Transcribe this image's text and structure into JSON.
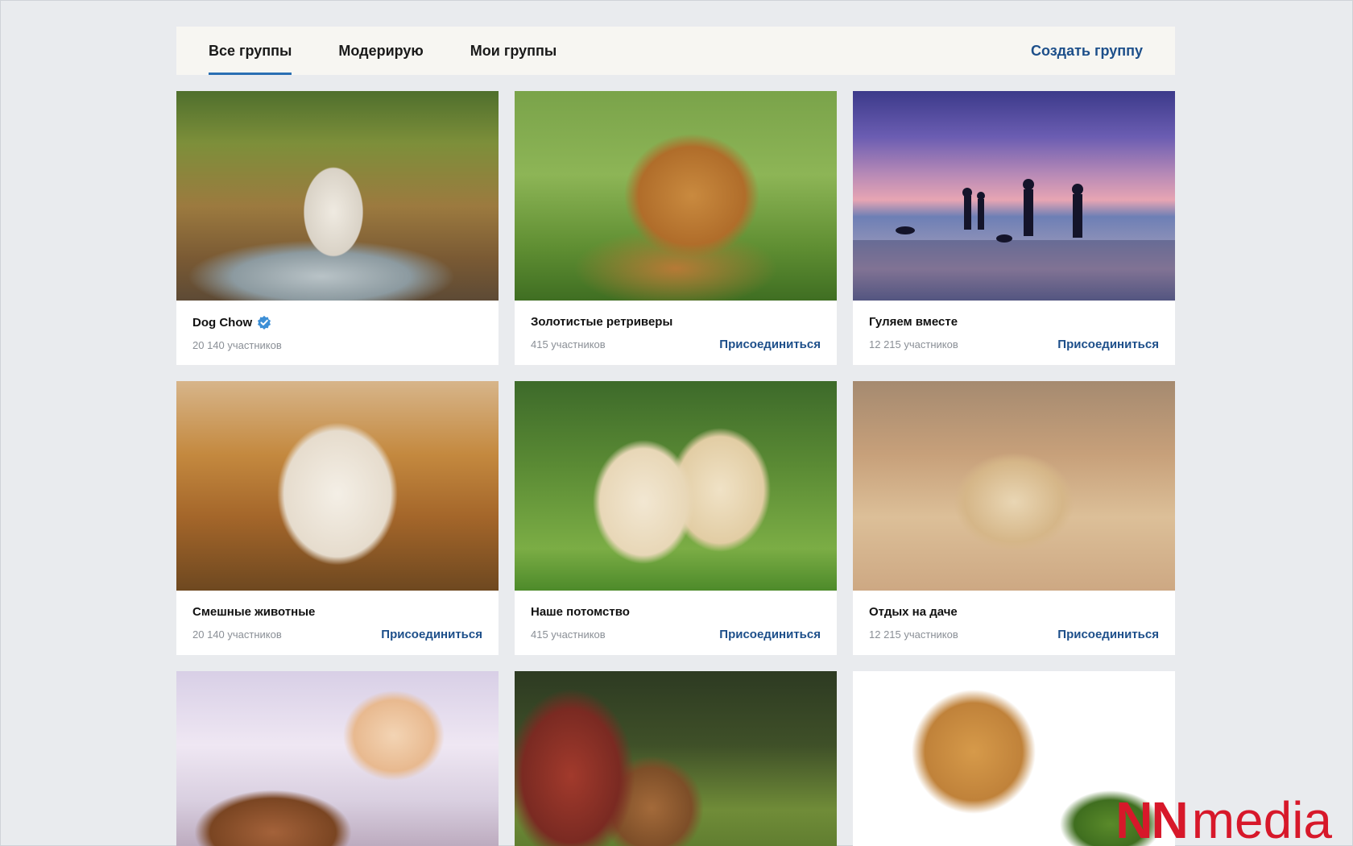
{
  "tabs": {
    "all_groups": "Все группы",
    "moderating": "Модерирую",
    "my_groups": "Мои группы",
    "active": "all_groups"
  },
  "create_group": "Создать группу",
  "join_label": "Присоединиться",
  "accent_color": "#2a6fb3",
  "link_color": "#1d4f8a",
  "groups": [
    {
      "title": "Dog Chow",
      "members": "20 140 участников",
      "verified": true,
      "show_join": false
    },
    {
      "title": "Золотистые ретриверы",
      "members": "415 участников",
      "verified": false,
      "show_join": true
    },
    {
      "title": "Гуляем вместе",
      "members": "12 215 участников",
      "verified": false,
      "show_join": true
    },
    {
      "title": "Смешные животные",
      "members": "20 140 участников",
      "verified": false,
      "show_join": true
    },
    {
      "title": "Наше потомство",
      "members": "415 участников",
      "verified": false,
      "show_join": true
    },
    {
      "title": "Отдых на даче",
      "members": "12 215 участников",
      "verified": false,
      "show_join": true
    }
  ],
  "watermark": {
    "logo": "NN",
    "text": "media"
  }
}
